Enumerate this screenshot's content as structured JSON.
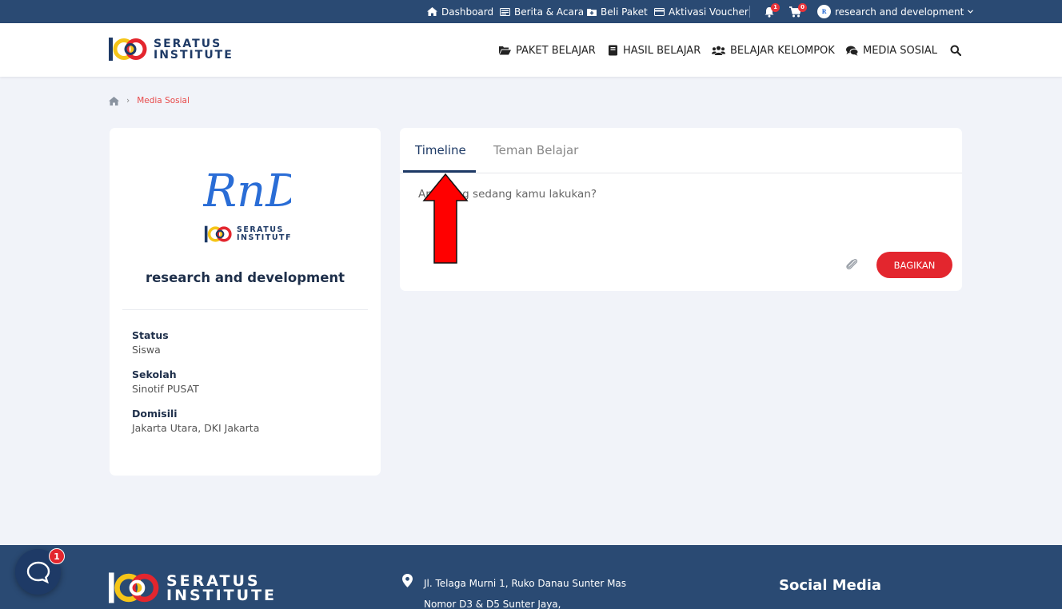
{
  "topbar": {
    "dashboard": "Dashboard",
    "news": "Berita & Acara",
    "buy": "Beli Paket",
    "voucher": "Aktivasi Voucher",
    "notif_count": "1",
    "cart_count": "0",
    "user": "research and development"
  },
  "header": {
    "logo_line1": "SERATUS",
    "logo_line2": "INSTITUTE",
    "nav": [
      "PAKET BELAJAR",
      "HASIL BELAJAR",
      "BELAJAR KELOMPOK",
      "MEDIA SOSIAL"
    ]
  },
  "breadcrumb": {
    "sep": "›",
    "current": "Media Sosial"
  },
  "profile": {
    "logo_text": "RnD",
    "sub_line1": "SERATUS",
    "sub_line2": "INSTITUTF",
    "name": "research and development",
    "fields": [
      {
        "label": "Status",
        "value": "Siswa"
      },
      {
        "label": "Sekolah",
        "value": "Sinotif PUSAT"
      },
      {
        "label": "Domisili",
        "value": "Jakarta Utara, DKI Jakarta"
      }
    ]
  },
  "post": {
    "tabs": [
      "Timeline",
      "Teman Belajar"
    ],
    "placeholder": "Apa yang sedang kamu lakukan?",
    "share_label": "BAGIKAN"
  },
  "footer": {
    "logo_line1": "SERATUS",
    "logo_line2": "INSTITUTE",
    "address_line1": "Jl. Telaga Murni 1, Ruko Danau Sunter Mas",
    "address_line2": "Nomor D3 & D5 Sunter Jaya,",
    "social_title": "Social Media"
  },
  "chat": {
    "badge": "1"
  },
  "colors": {
    "navy": "#2a4a73",
    "accent_red": "#e3262e",
    "bg": "#f1f3f9"
  }
}
